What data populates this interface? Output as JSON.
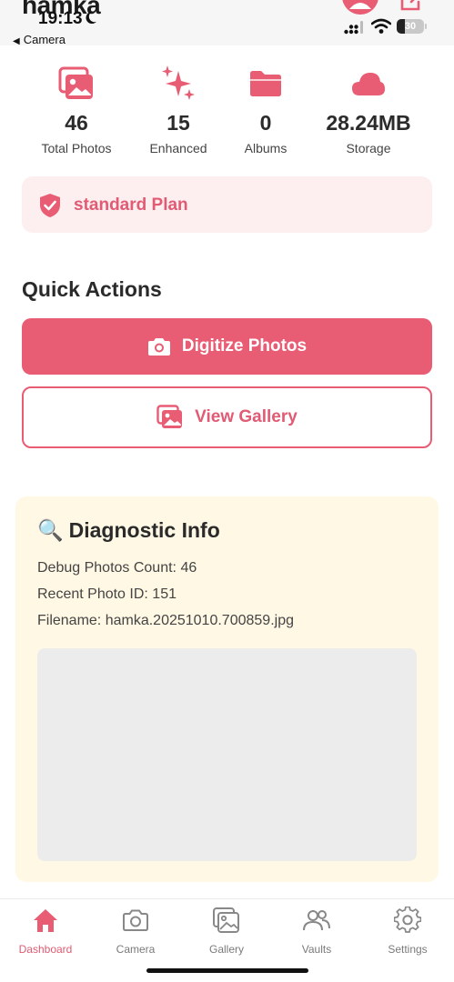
{
  "app": {
    "title": "hamka"
  },
  "status": {
    "time": "19:13",
    "back_label": "Camera",
    "battery": "30",
    "battery_level": 0.3
  },
  "stats": [
    {
      "value": "46",
      "label": "Total Photos",
      "icon": "photos-icon"
    },
    {
      "value": "15",
      "label": "Enhanced",
      "icon": "sparkles-icon"
    },
    {
      "value": "0",
      "label": "Albums",
      "icon": "folder-icon"
    },
    {
      "value": "28.24MB",
      "label": "Storage",
      "icon": "cloud-icon"
    }
  ],
  "plan": {
    "label": "standard Plan",
    "icon": "shield-check-icon"
  },
  "quick_actions": {
    "title": "Quick Actions",
    "digitize_label": "Digitize Photos",
    "gallery_label": "View Gallery"
  },
  "diagnostic": {
    "emoji": "🔍",
    "title": "Diagnostic Info",
    "count_line": "Debug Photos Count: 46",
    "recent_id_line": "Recent Photo ID: 151",
    "filename_line": "Filename: hamka.20251010.700859.jpg"
  },
  "tabs": [
    {
      "label": "Dashboard",
      "icon": "home-icon",
      "active": true
    },
    {
      "label": "Camera",
      "icon": "camera-icon",
      "active": false
    },
    {
      "label": "Gallery",
      "icon": "gallery-icon",
      "active": false
    },
    {
      "label": "Vaults",
      "icon": "users-icon",
      "active": false
    },
    {
      "label": "Settings",
      "icon": "gear-icon",
      "active": false
    }
  ],
  "colors": {
    "accent": "#e85c74",
    "plan_bg": "#fdeef0",
    "diag_bg": "#fff8e4",
    "preview_bg": "#ececec"
  }
}
